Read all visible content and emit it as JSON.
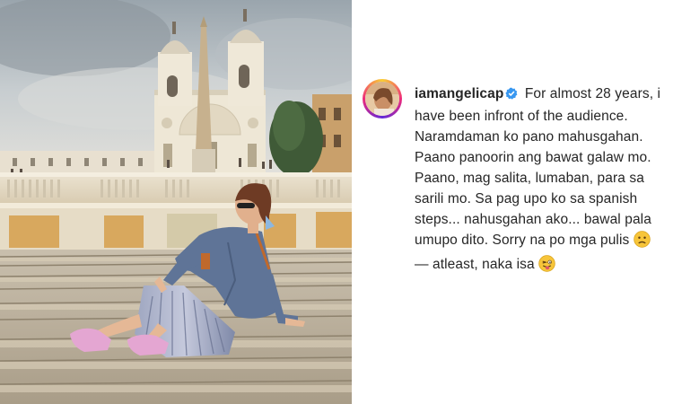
{
  "post": {
    "username": "iamangelicap",
    "verified": true,
    "caption_lines": [
      "For almost 28 years, i",
      "have been infront of the audience.",
      "Naramdaman ko pano mahusgahan.",
      "Paano panoorin ang bawat galaw mo.",
      "Paano, mag salita, lumaban, para sa",
      "sarili mo. Sa pag upo ko sa spanish",
      "steps... nahusgahan ako... bawal pala",
      "umupo dito. Sorry na po mga pulis",
      "— atleast, naka isa"
    ],
    "emoji_1": "worried-face",
    "emoji_2": "winking-face-with-tongue"
  },
  "colors": {
    "verified_badge": "#3897f0",
    "text": "#262626",
    "story_ring": [
      "#f9ce34",
      "#ee2a7b",
      "#6228d7"
    ]
  }
}
